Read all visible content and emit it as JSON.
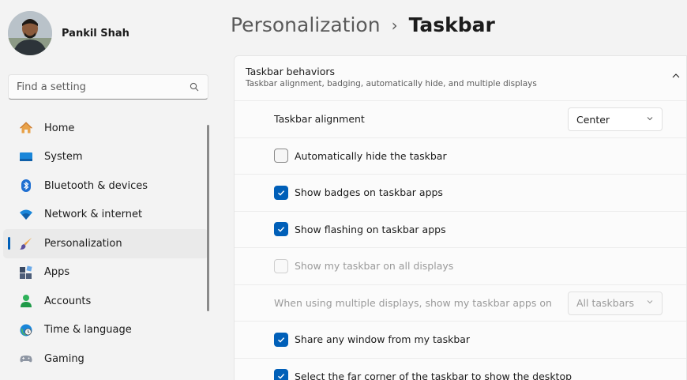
{
  "profile": {
    "name": "Pankil Shah"
  },
  "search": {
    "placeholder": "Find a setting"
  },
  "sidebar": {
    "items": [
      {
        "label": "Home",
        "icon": "home-icon"
      },
      {
        "label": "System",
        "icon": "system-icon"
      },
      {
        "label": "Bluetooth & devices",
        "icon": "bluetooth-icon"
      },
      {
        "label": "Network & internet",
        "icon": "wifi-icon"
      },
      {
        "label": "Personalization",
        "icon": "brush-icon",
        "active": true
      },
      {
        "label": "Apps",
        "icon": "apps-icon"
      },
      {
        "label": "Accounts",
        "icon": "accounts-icon"
      },
      {
        "label": "Time & language",
        "icon": "globe-clock-icon"
      },
      {
        "label": "Gaming",
        "icon": "gamepad-icon"
      }
    ]
  },
  "breadcrumb": {
    "parent": "Personalization",
    "separator": "›",
    "current": "Taskbar"
  },
  "section": {
    "title": "Taskbar behaviors",
    "subtitle": "Taskbar alignment, badging, automatically hide, and multiple displays"
  },
  "settings": {
    "alignment": {
      "label": "Taskbar alignment",
      "value": "Center"
    },
    "auto_hide": {
      "label": "Automatically hide the taskbar",
      "checked": false
    },
    "badges": {
      "label": "Show badges on taskbar apps",
      "checked": true
    },
    "flashing": {
      "label": "Show flashing on taskbar apps",
      "checked": true
    },
    "all_displays": {
      "label": "Show my taskbar on all displays",
      "checked": false,
      "disabled": true
    },
    "multi_display": {
      "label": "When using multiple displays, show my taskbar apps on",
      "value": "All taskbars",
      "disabled": true
    },
    "share_window": {
      "label": "Share any window from my taskbar",
      "checked": true
    },
    "far_corner": {
      "label": "Select the far corner of the taskbar to show the desktop",
      "checked": true
    }
  },
  "colors": {
    "accent": "#005fb8",
    "background": "#f3f3f3",
    "panel": "#fbfbfb"
  }
}
